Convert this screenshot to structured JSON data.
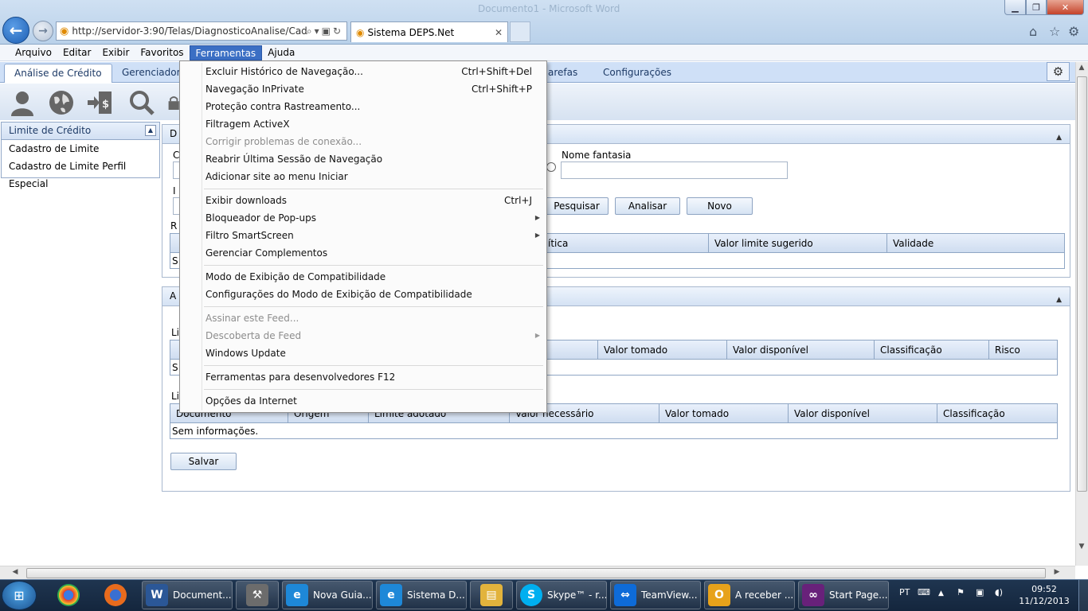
{
  "browser": {
    "window_title": "Documento1 - Microsoft Word",
    "address": "http://servidor-3:90/Telas/DiagnosticoAnalise/Cad;",
    "tab_title": "Sistema DEPS.Net"
  },
  "menubar": {
    "items": [
      "Arquivo",
      "Editar",
      "Exibir",
      "Favoritos",
      "Ferramentas",
      "Ajuda"
    ]
  },
  "dropdown": {
    "items": [
      {
        "label": "Excluir Histórico de Navegação...",
        "shortcut": "Ctrl+Shift+Del"
      },
      {
        "label": "Navegação InPrivate",
        "shortcut": "Ctrl+Shift+P"
      },
      {
        "label": "Proteção contra Rastreamento...",
        "shortcut": ""
      },
      {
        "label": "Filtragem ActiveX",
        "shortcut": ""
      },
      {
        "label": "Corrigir problemas de conexão...",
        "shortcut": ""
      },
      {
        "label": "Reabrir Última Sessão de Navegação",
        "shortcut": ""
      },
      {
        "label": "Adicionar site ao menu Iniciar",
        "shortcut": ""
      },
      {
        "label": "Exibir downloads",
        "shortcut": "Ctrl+J"
      },
      {
        "label": "Bloqueador de Pop-ups",
        "shortcut": ""
      },
      {
        "label": "Filtro SmartScreen",
        "shortcut": ""
      },
      {
        "label": "Gerenciar Complementos",
        "shortcut": ""
      },
      {
        "label": "Modo de Exibição de Compatibilidade",
        "shortcut": ""
      },
      {
        "label": "Configurações do Modo de Exibição de Compatibilidade",
        "shortcut": ""
      },
      {
        "label": "Assinar este Feed...",
        "shortcut": ""
      },
      {
        "label": "Descoberta de Feed",
        "shortcut": ""
      },
      {
        "label": "Windows Update",
        "shortcut": ""
      },
      {
        "label": "Ferramentas para desenvolvedores F12",
        "shortcut": ""
      },
      {
        "label": "Opções da Internet",
        "shortcut": ""
      }
    ]
  },
  "app": {
    "tabs": [
      "Análise de Crédito",
      "Gerenciador d",
      "arefas",
      "Configurações"
    ],
    "sidebar": {
      "title": "Limite de Crédito",
      "items": [
        "Cadastro de Limite",
        "Cadastro de Limite Perfil Especial"
      ]
    },
    "panel1": {
      "title_fragment": "D",
      "label_frag_1": "C",
      "label_frag_2": "I",
      "label_frag_3": "R",
      "nome_fantasia_label": "Nome fantasia",
      "buttons": [
        "Pesquisar",
        "Analisar",
        "Novo"
      ],
      "grid_headers": [
        "ítica",
        "Valor limite sugerido",
        "Validade"
      ],
      "grid_empty_fragment": "S"
    },
    "panel2": {
      "title_fragment": "A",
      "grid1_label_fragment": "Li",
      "grid1_headers": [
        "Valor tomado",
        "Valor disponível",
        "Classificação",
        "Risco"
      ],
      "grid1_empty_fragment": "S",
      "grid2_label_fragment": "Li",
      "grid2_headers": [
        "Documento",
        "Origem",
        "Limite adotado",
        "Valor necessário",
        "Valor tomado",
        "Valor disponível",
        "Classificação"
      ],
      "grid2_empty": "Sem informações.",
      "save_label": "Salvar"
    }
  },
  "taskbar": {
    "items": [
      {
        "label": "Document...",
        "icon": "word-icon",
        "color": "#2b5797",
        "glyph": "W"
      },
      {
        "label": "",
        "icon": "tools-icon",
        "color": "#6c6c6c",
        "glyph": "⚒"
      },
      {
        "label": "Nova Guia...",
        "icon": "ie-icon",
        "color": "#1e88d8",
        "glyph": "e"
      },
      {
        "label": "Sistema D...",
        "icon": "ie-icon",
        "color": "#1e88d8",
        "glyph": "e"
      },
      {
        "label": "",
        "icon": "folder-icon",
        "color": "#e2b33c",
        "glyph": "▤"
      },
      {
        "label": "Skype™ - r...",
        "icon": "skype-icon",
        "color": "#00aff0",
        "glyph": "S"
      },
      {
        "label": "TeamView...",
        "icon": "teamviewer-icon",
        "color": "#0e6bd8",
        "glyph": "⇔"
      },
      {
        "label": "A receber ...",
        "icon": "outlook-icon",
        "color": "#e7a21b",
        "glyph": "O"
      },
      {
        "label": "Start Page...",
        "icon": "visualstudio-icon",
        "color": "#68217a",
        "glyph": "∞"
      }
    ],
    "lang": "PT",
    "time": "09:52",
    "date": "11/12/2013"
  }
}
